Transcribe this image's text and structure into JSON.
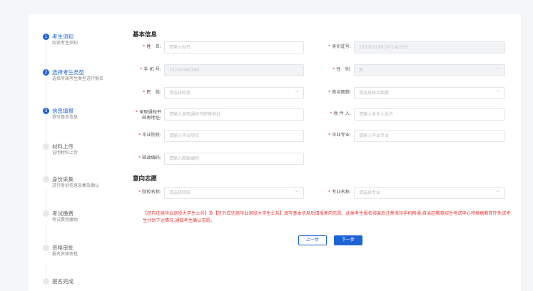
{
  "sidebar": {
    "steps": [
      {
        "num": "1",
        "title": "考生须知",
        "sub": "阅读考生须知",
        "active": true
      },
      {
        "num": "2",
        "title": "选择考生类型",
        "sub": "选择所属考生类型进行报名",
        "active": true
      },
      {
        "num": "3",
        "title": "信息填报",
        "sub": "填写基本信息",
        "active": true
      },
      {
        "num": "",
        "title": "材料上传",
        "sub": "证明材料上传",
        "active": false
      },
      {
        "num": "",
        "title": "身份采集",
        "sub": "进行身份信息采集及确认",
        "active": false
      },
      {
        "num": "",
        "title": "考试缴费",
        "sub": "考试费用缴纳",
        "active": false
      },
      {
        "num": "",
        "title": "资格审批",
        "sub": "报名资格审批",
        "active": false
      },
      {
        "num": "",
        "title": "报名完成",
        "sub": "",
        "active": false
      }
    ]
  },
  "basic": {
    "title": "基本信息",
    "name": {
      "label": "姓　名:",
      "placeholder": "请输入姓名"
    },
    "id_card": {
      "label": "身份证号:",
      "value": "150302199107142555"
    },
    "phone": {
      "label": "手 机 号:",
      "value": "15245180160"
    },
    "gender": {
      "label": "性　别:",
      "value": "男"
    },
    "ethnicity": {
      "label": "民　族:",
      "placeholder": "请选择民族"
    },
    "politics": {
      "label": "政治面貌:",
      "placeholder": "请选择政治面貌"
    },
    "address": {
      "label": "录取通知书邮寄地址:",
      "placeholder": "请输入录取通知书邮寄地址"
    },
    "recipient": {
      "label": "收 件 人:",
      "placeholder": "请输入收件人姓名"
    },
    "school": {
      "label": "毕业院校:",
      "placeholder": "请输入毕业院校"
    },
    "major": {
      "label": "毕业专业:",
      "placeholder": "请输入毕业专业"
    },
    "postcode": {
      "label": "邮政编码:",
      "placeholder": "请输入邮政编码"
    }
  },
  "intent": {
    "title": "意向志愿",
    "school": {
      "label": "院校名称:",
      "placeholder": "请选择院校"
    },
    "major": {
      "label": "专业名称:",
      "placeholder": "请选择专业"
    }
  },
  "notice": "【区内往届毕业退役大学生士兵】及【区外应往届毕业退役大学生士兵】填写基本信息后请报意向志愿。此类考生报名结束后注意保持手机畅通,自治区教育招生考试中心将根据教育厅免试考生计划下达情况,通知考生确认志愿。",
  "buttons": {
    "prev": "上一步",
    "next": "下一步"
  },
  "colors": {
    "accent": "#1e63d6",
    "required": "#e53935"
  }
}
